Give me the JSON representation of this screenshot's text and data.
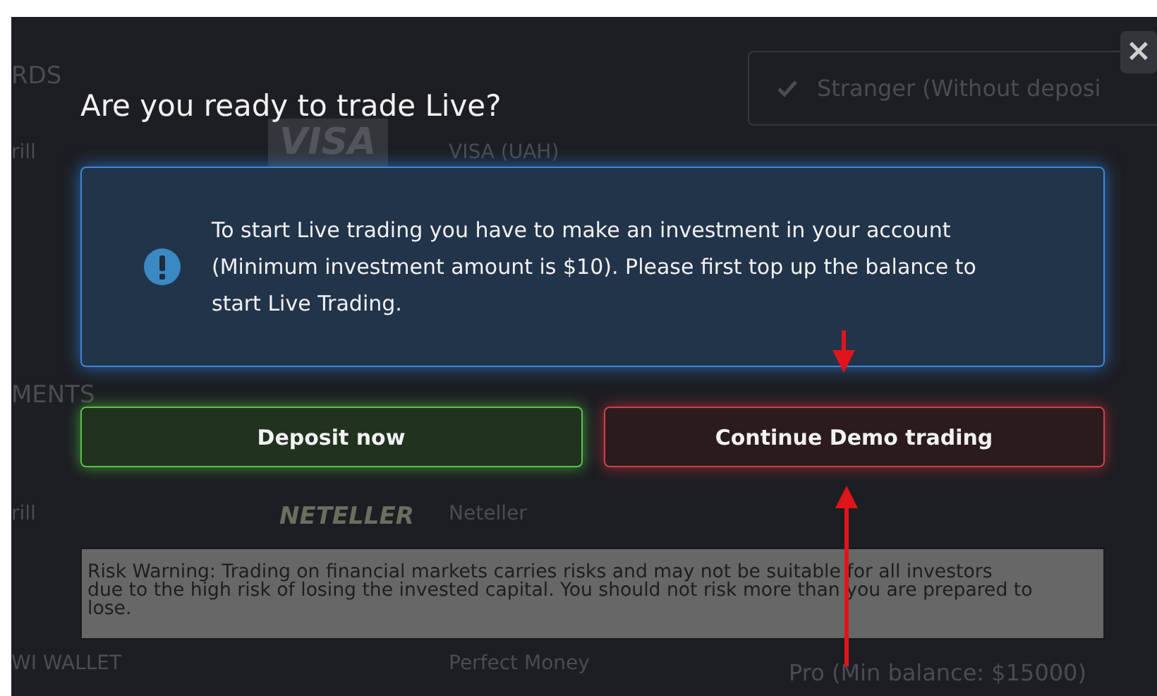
{
  "background": {
    "sections": [
      {
        "heading": "RDS",
        "methods": [
          {
            "provider": "rill",
            "logo": "VISA",
            "name": "VISA (UAH)"
          }
        ]
      },
      {
        "heading": "MENTS",
        "methods": [
          {
            "provider": "rill",
            "logo": "NETELLER",
            "name": "Neteller"
          },
          {
            "provider": "WI WALLET",
            "name": "Perfect Money"
          }
        ]
      }
    ],
    "levels": [
      {
        "text": "Stranger (Without deposi",
        "checked": true
      },
      {
        "text": "Pro (Min balance: $15000)",
        "checked": false
      }
    ]
  },
  "dialog": {
    "close": "×",
    "title": "Are you ready to trade Live?",
    "message": "To start Live trading you have to make an investment in your account (Minimum investment amount is $10). Please first top up the balance to start Live Trading.",
    "buttons": [
      {
        "label": "Deposit now",
        "kind": "deposit"
      },
      {
        "label": "Continue Demo trading",
        "kind": "demo"
      }
    ],
    "risk_warning": "Risk Warning: Trading on financial markets carries risks and may not be suitable for all investors due to the high risk of losing the invested capital. You should not risk more than you are prepared to lose."
  }
}
